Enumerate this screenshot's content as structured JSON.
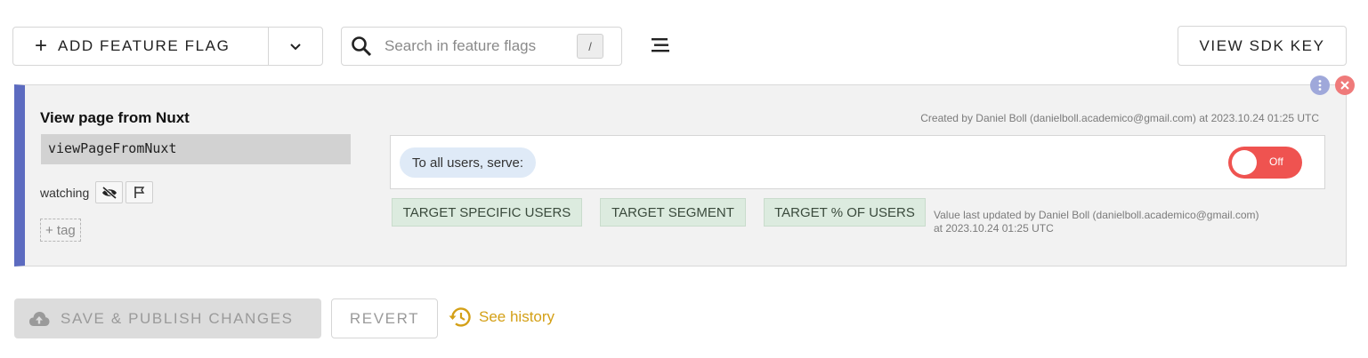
{
  "toolbar": {
    "add_flag_label": "ADD FEATURE FLAG",
    "add_flag_icon": "plus-icon",
    "dropdown_icon": "chevron-down-icon",
    "search_placeholder": "Search in feature flags",
    "search_value": "",
    "search_shortcut": "/",
    "menu_icon": "hamburger-menu-icon",
    "sdk_key_label": "VIEW SDK KEY"
  },
  "flag": {
    "name": "View page from Nuxt",
    "key": "viewPageFromNuxt",
    "watching_label": "watching",
    "tag_button_label": "+ tag",
    "created_text": "Created by Daniel Boll (danielboll.academico@gmail.com) at 2023.10.24 01:25 UTC",
    "serve_label": "To all users, serve:",
    "toggle_label": "Off",
    "toggle_state": "off",
    "target_buttons": [
      "TARGET SPECIFIC USERS",
      "TARGET SEGMENT",
      "TARGET % OF USERS"
    ],
    "updated_line1": "Value last updated by Daniel Boll (danielboll.academico@gmail.com)",
    "updated_line2": "at 2023.10.24 01:25 UTC"
  },
  "actions": {
    "save_label": "SAVE & PUBLISH CHANGES",
    "revert_label": "REVERT",
    "history_label": "See history"
  },
  "colors": {
    "accent_bar": "#5c6bc0",
    "toggle_off": "#ef5350",
    "history": "#d4a017",
    "target_bg": "#dcebdf"
  }
}
